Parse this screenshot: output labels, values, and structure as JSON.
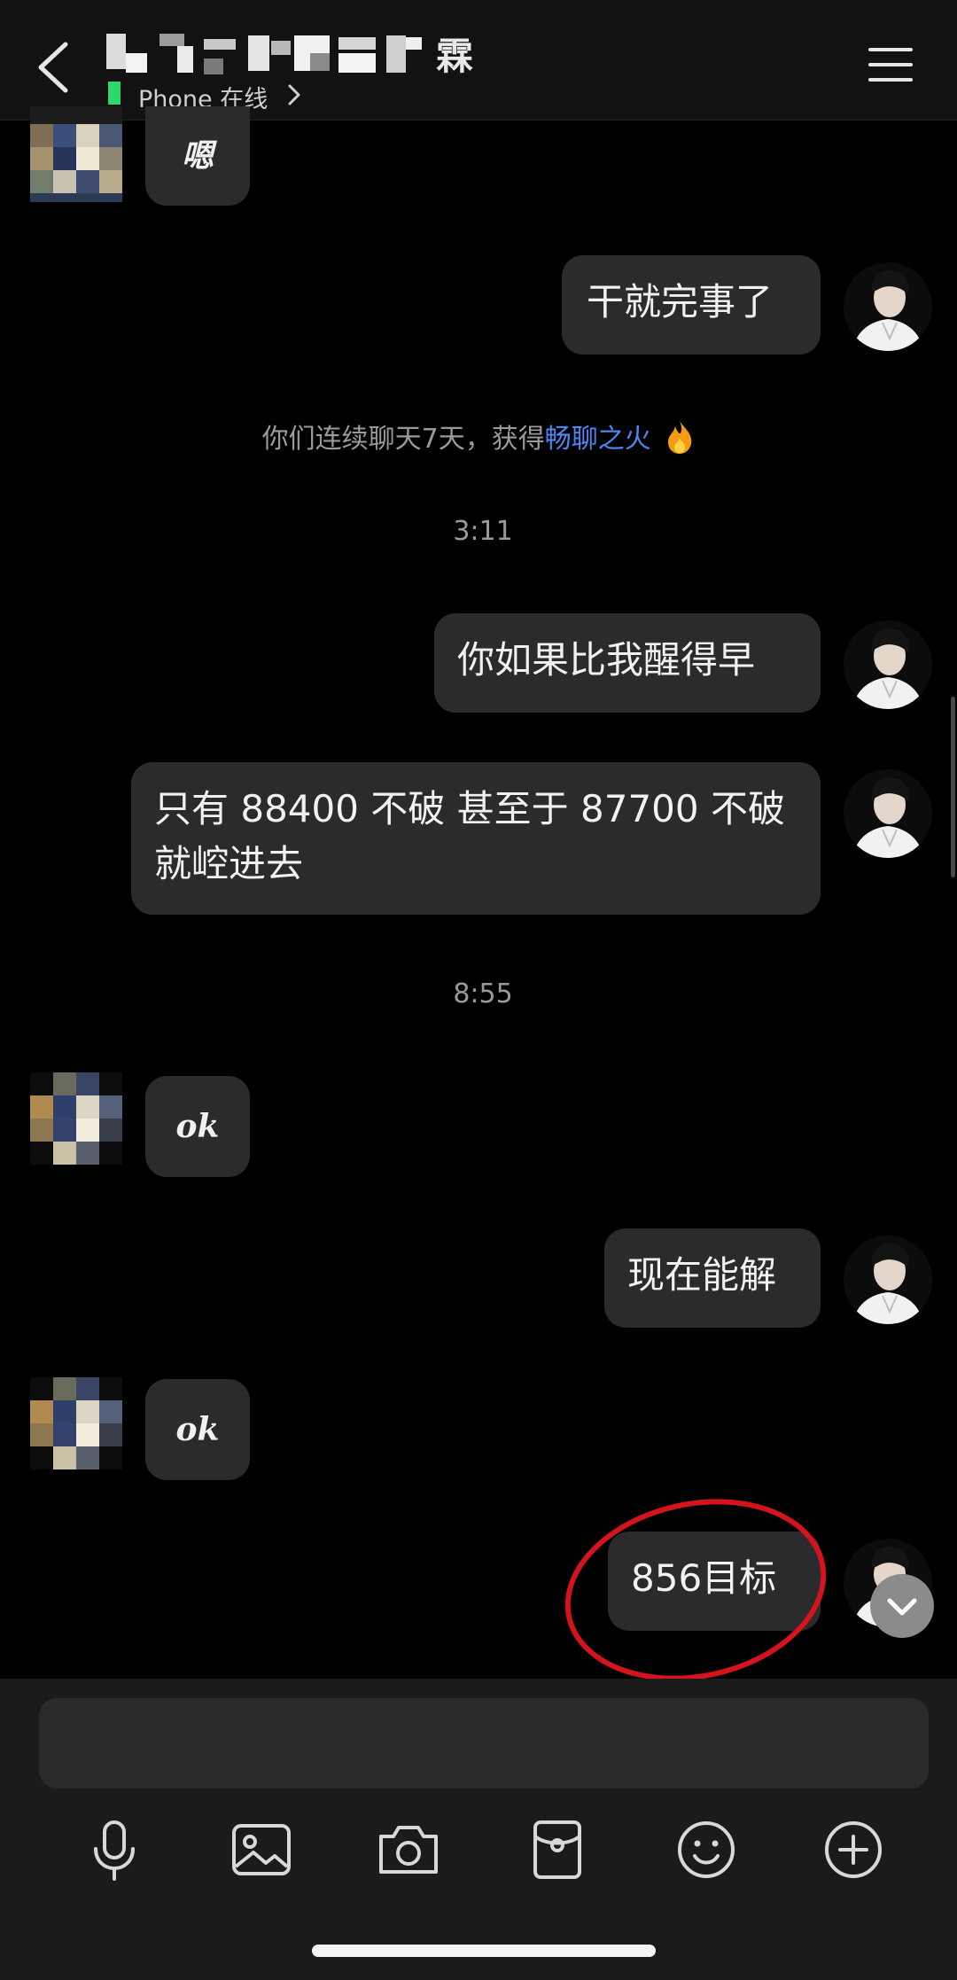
{
  "header": {
    "title_suffix": "霖",
    "status": "Phone 在线"
  },
  "messages": {
    "m1": "嗯",
    "m2": "干就完事了",
    "system_prefix": "你们连续聊天7天，获得",
    "system_badge": "畅聊之火",
    "time1": "3:11",
    "m3": "你如果比我醒得早",
    "m4": "只有 88400 不破 甚至于 87700 不破 就崆进去",
    "time2": "8:55",
    "m5": "ok",
    "m6": "现在能解",
    "m7": "ok",
    "m8": "856目标"
  },
  "icons": {
    "back": "chevron-left-icon",
    "menu": "hamburger-menu-icon",
    "status": "chevron-right-icon",
    "fire": "fire-icon",
    "scroll": "chevron-down-icon",
    "tools": [
      "microphone-icon",
      "image-icon",
      "camera-icon",
      "red-packet-icon",
      "emoji-icon",
      "plus-circle-icon"
    ]
  },
  "colors": {
    "background": "#000000",
    "bubble": "#2b2b2d",
    "accent_link": "#4d86f2",
    "online": "#2fd66b",
    "highlight_ring": "#d3141c"
  }
}
